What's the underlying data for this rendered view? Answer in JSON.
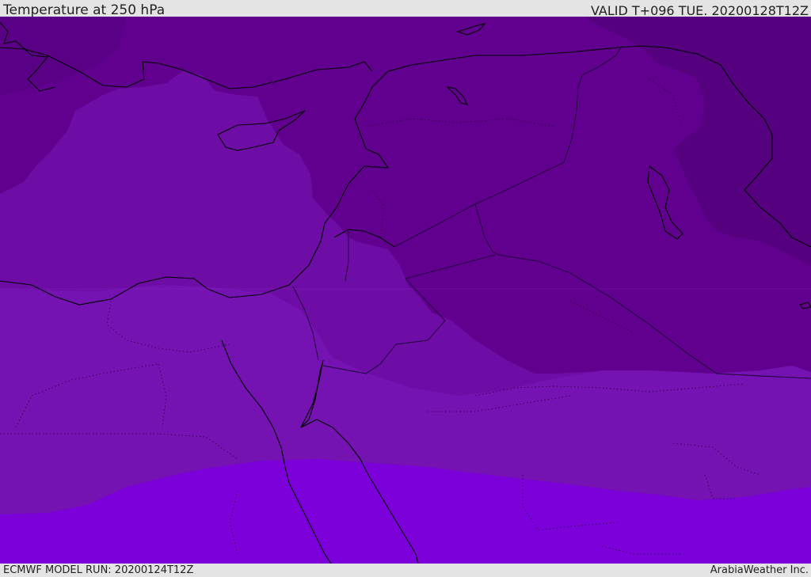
{
  "header": {
    "title": "Temperature at 250 hPa",
    "valid": "VALID T+096 TUE. 20200128T12Z"
  },
  "footer": {
    "model_run": "ECMWF MODEL RUN: 20200124T12Z",
    "credit": "ArabiaWeather Inc."
  },
  "map": {
    "field_colors": {
      "coldest": "#55007f",
      "cold": "#61008f",
      "mid": "#6e0ca6",
      "warm": "#7412b2",
      "warmest": "#7b00da"
    },
    "coastline_color": "#000000"
  }
}
